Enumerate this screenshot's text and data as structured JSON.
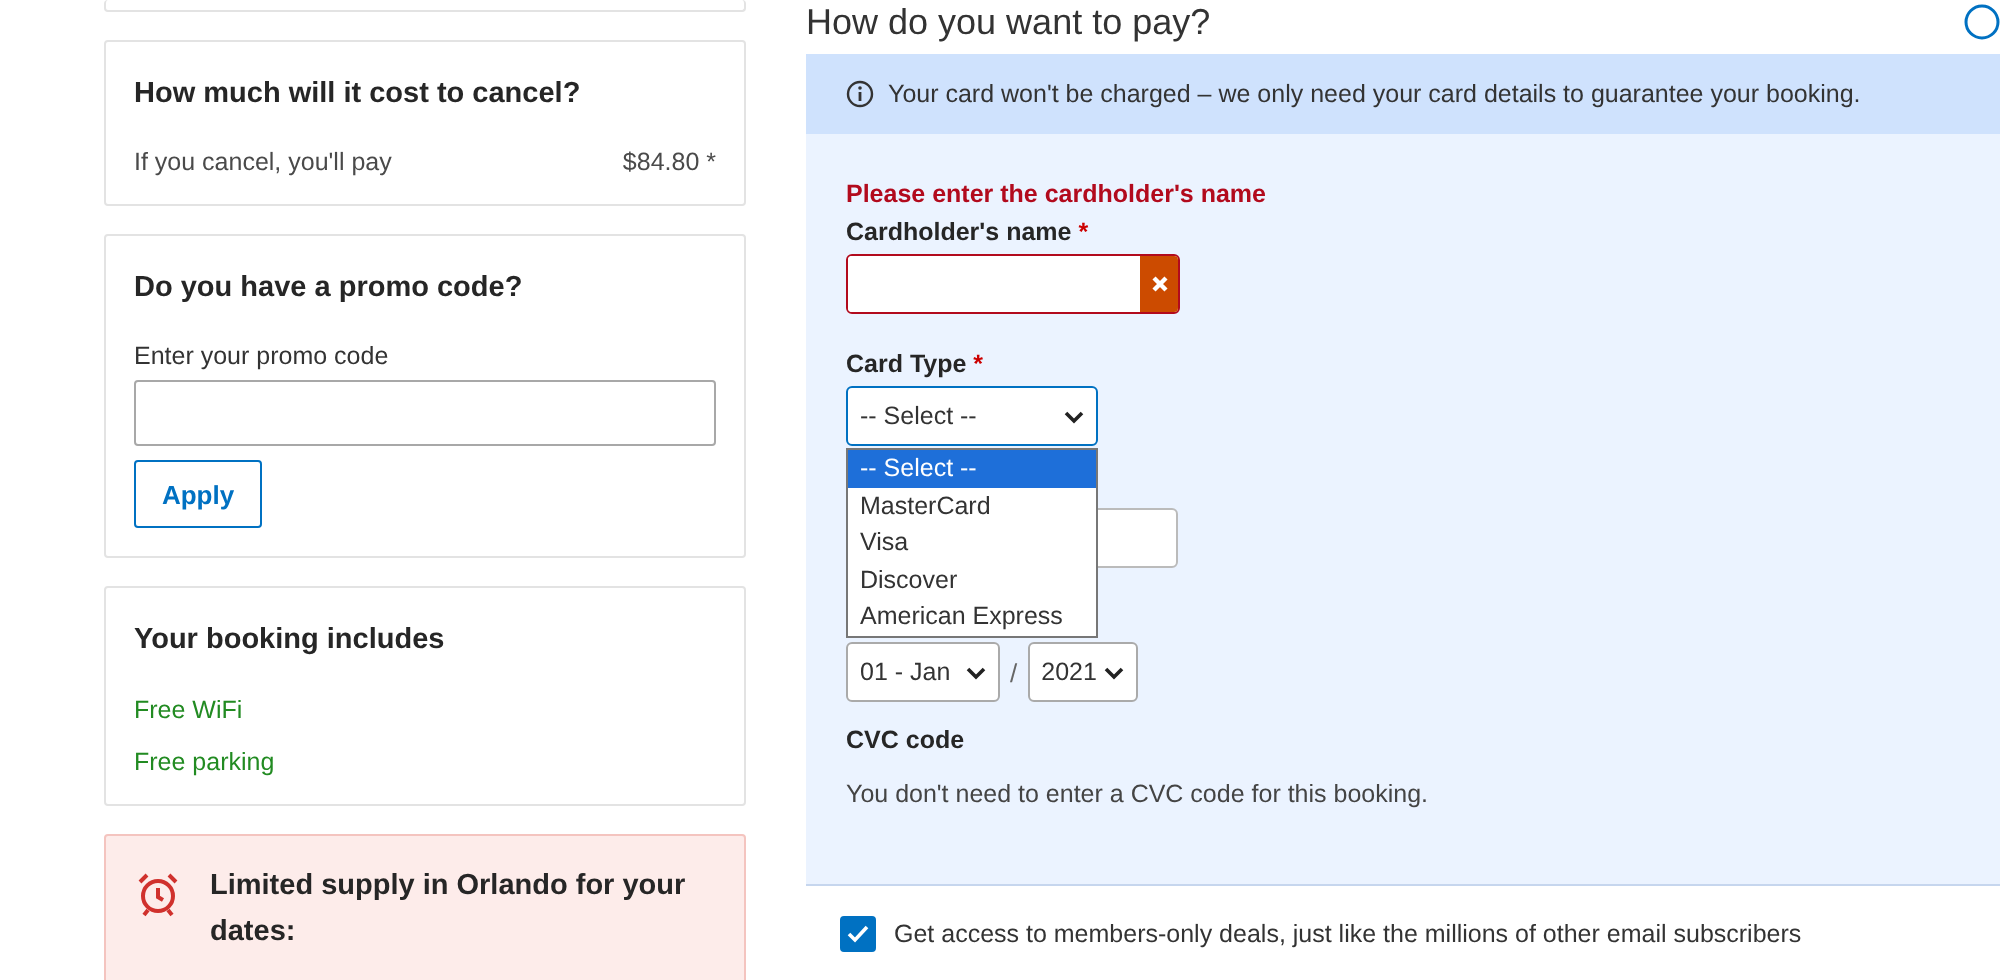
{
  "cancel_card": {
    "title": "How much will it cost to cancel?",
    "label": "If you cancel, you'll pay",
    "amount": "$84.80 *"
  },
  "promo_card": {
    "title": "Do you have a promo code?",
    "field_label": "Enter your promo code",
    "button": "Apply"
  },
  "includes_card": {
    "title": "Your booking includes",
    "items": [
      "Free WiFi",
      "Free parking"
    ]
  },
  "supply_card": {
    "title": "Limited supply in Orlando for your dates:"
  },
  "payment": {
    "title": "How do you want to pay?",
    "notice": "Your card won't be charged – we only need your card details to guarantee your booking.",
    "error": "Please enter the cardholder's name",
    "cardholder": {
      "label": "Cardholder's name",
      "required_mark": "*",
      "invalid": true
    },
    "card_type": {
      "label": "Card Type",
      "required_mark": "*",
      "value": "-- Select --",
      "expanded": true,
      "options": [
        {
          "label": "-- Select --",
          "selected": true
        },
        {
          "label": "MasterCard",
          "selected": false
        },
        {
          "label": "Visa",
          "selected": false
        },
        {
          "label": "Discover",
          "selected": false
        },
        {
          "label": "American Express",
          "selected": false
        }
      ]
    },
    "expiry": {
      "month": "01 - Jan",
      "separator": "/",
      "year": "2021"
    },
    "cvc": {
      "title": "CVC code",
      "note": "You don't need to enter a CVC code for this booking."
    }
  },
  "subscribe": {
    "checked": true,
    "label": "Get access to members-only deals, just like the millions of other email subscribers"
  }
}
